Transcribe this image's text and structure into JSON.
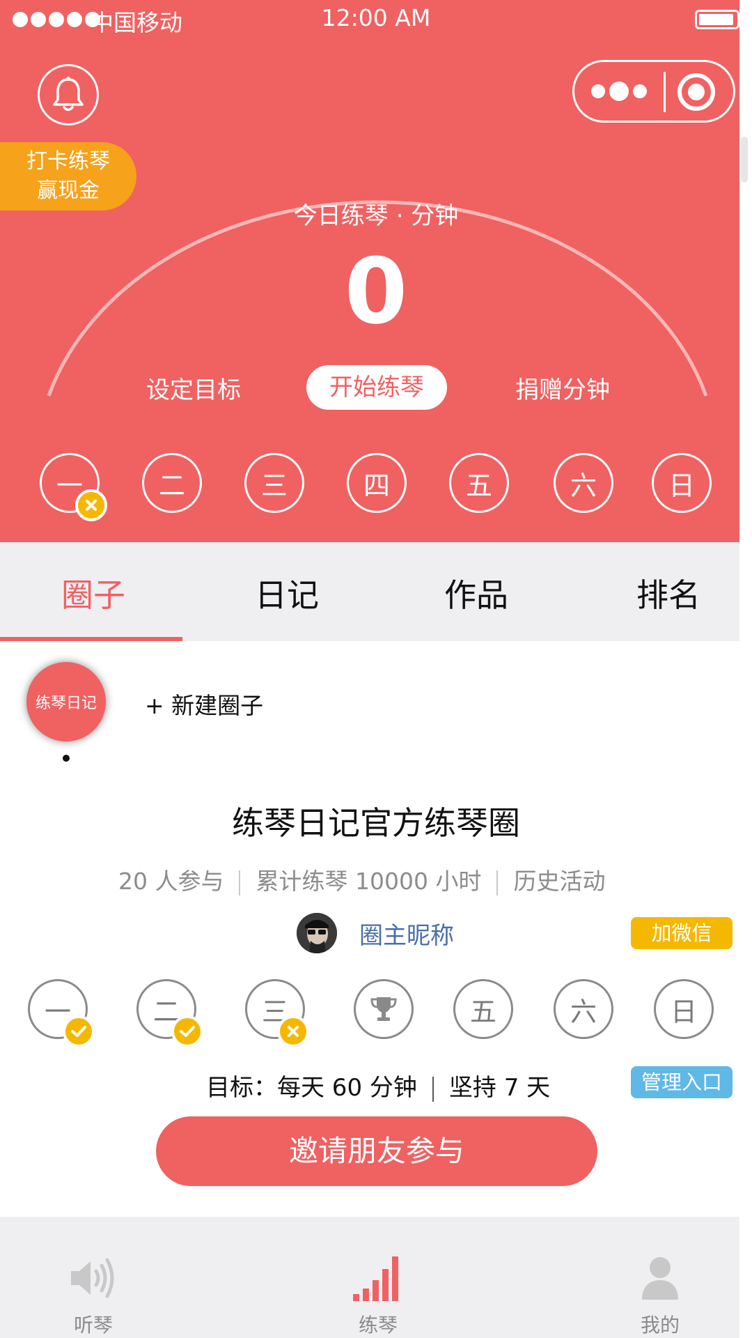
{
  "status_bar": {
    "carrier": "中国移动",
    "time": "12:00 AM"
  },
  "promo": {
    "line1": "打卡练琴",
    "line2": "赢现金"
  },
  "today": {
    "label": "今日练琴 · 分钟",
    "minutes": "0"
  },
  "actions": {
    "set_goal": "设定目标",
    "start": "开始练琴",
    "donate": "捐赠分钟"
  },
  "week_days": [
    {
      "label": "一",
      "status": "missed"
    },
    {
      "label": "二"
    },
    {
      "label": "三"
    },
    {
      "label": "四"
    },
    {
      "label": "五"
    },
    {
      "label": "六"
    },
    {
      "label": "日"
    }
  ],
  "tabs": [
    {
      "label": "圈子",
      "active": true
    },
    {
      "label": "日记"
    },
    {
      "label": "作品"
    },
    {
      "label": "排名"
    }
  ],
  "circle_avatar_label": "练琴日记",
  "new_circle_label": "+ 新建圈子",
  "circle": {
    "title": "练琴日记官方练琴圈",
    "participants": "20  人参与",
    "total": "累计练琴 10000 小时",
    "history": "历史活动",
    "owner": "圈主昵称",
    "wechat_btn": "加微信",
    "goal": "目标：每天 60 分钟",
    "persist": "坚持 7 天",
    "manage_btn": "管理入口",
    "invite_btn": "邀请朋友参与"
  },
  "circle_days": [
    {
      "label": "一",
      "status": "done"
    },
    {
      "label": "二",
      "status": "done"
    },
    {
      "label": "三",
      "status": "missed"
    },
    {
      "label": "",
      "status": "trophy"
    },
    {
      "label": "五"
    },
    {
      "label": "六"
    },
    {
      "label": "日"
    }
  ],
  "bottom_nav": [
    {
      "label": "听琴",
      "icon": "speaker-icon"
    },
    {
      "label": "练琴",
      "icon": "bar-chart-icon",
      "active": true
    },
    {
      "label": "我的",
      "icon": "user-icon"
    }
  ],
  "colors": {
    "primary": "#f06161",
    "yellow": "#f5b800",
    "orange": "#f7a21b",
    "blue": "#5fb8e6",
    "tab_bg": "#efeff2"
  }
}
